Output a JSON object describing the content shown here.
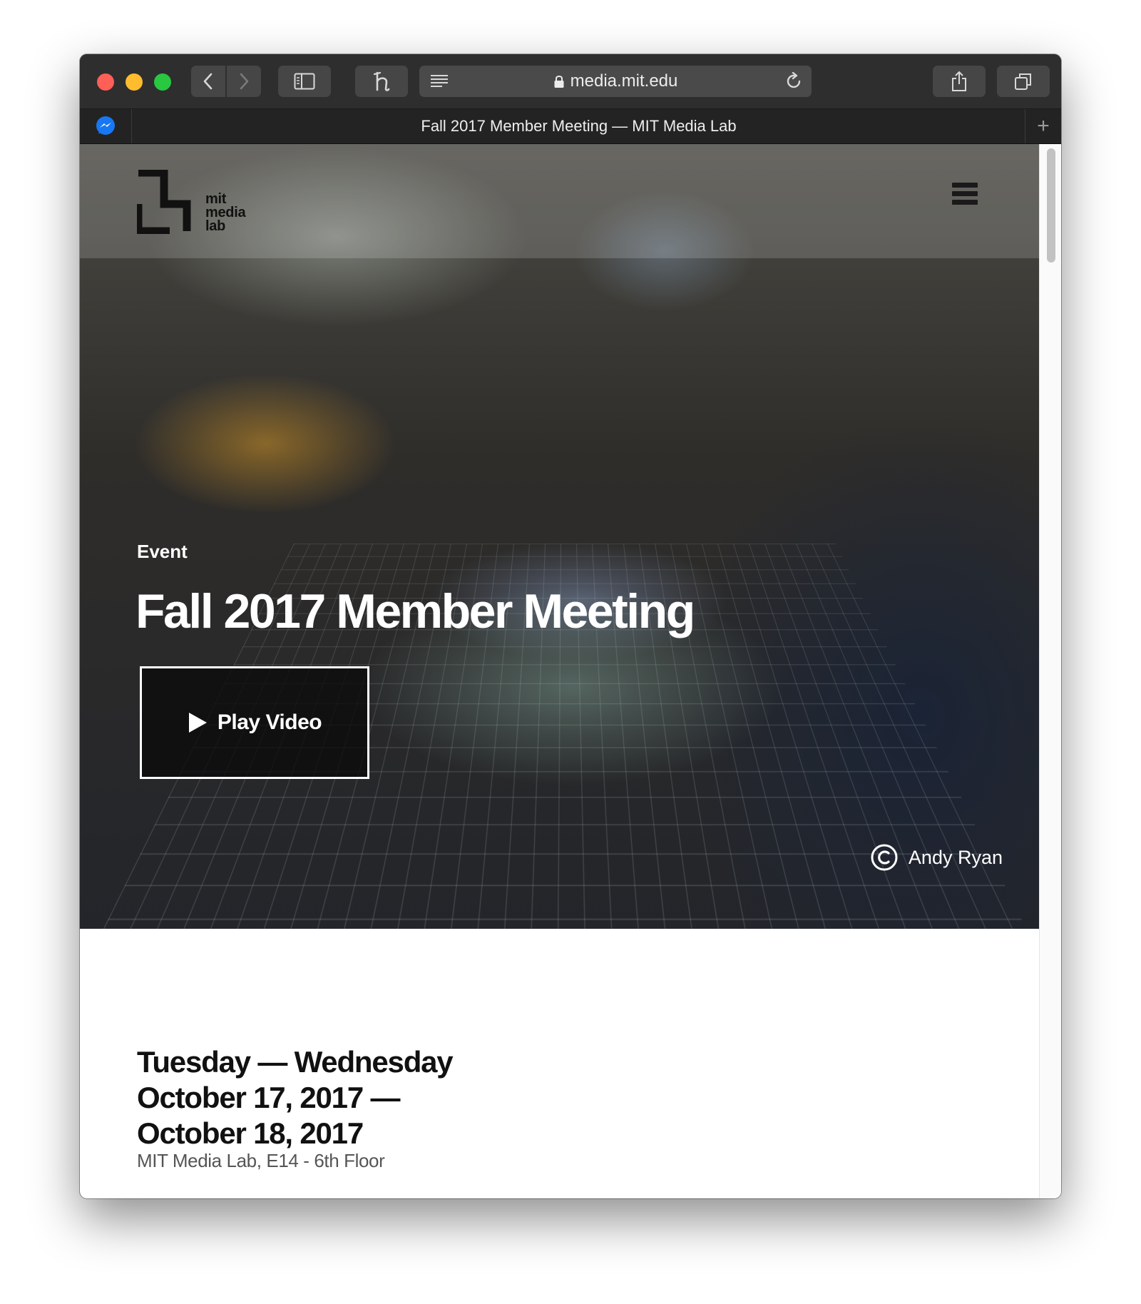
{
  "browser": {
    "url": "media.mit.edu",
    "tab_title": "Fall 2017 Member Meeting — MIT Media Lab",
    "new_tab_label": "+"
  },
  "site": {
    "logo_lines": [
      "mit",
      "media",
      "lab"
    ]
  },
  "hero": {
    "kicker": "Event",
    "title": "Fall 2017 Member Meeting",
    "play_label": "Play Video",
    "credit": "Andy Ryan"
  },
  "event": {
    "date_lines": [
      "Tuesday — Wednesday",
      "October 17, 2017 —",
      "October 18, 2017"
    ],
    "location": "MIT Media Lab, E14 - 6th Floor"
  },
  "icons": {
    "close": "close-circle",
    "minimize": "minimize-circle",
    "maximize": "maximize-circle",
    "back": "chevron-left-icon",
    "forward": "chevron-right-icon",
    "sidebar": "sidebar-icon",
    "extension": "extension-h-icon",
    "reader": "reader-lines-icon",
    "lock": "lock-icon",
    "reload": "reload-icon",
    "share": "share-icon",
    "tabs": "tabs-overview-icon",
    "messenger": "messenger-icon",
    "menu": "hamburger-menu-icon",
    "copyright": "copyright-icon"
  },
  "colors": {
    "toolbar": "#2e2e2e",
    "close": "#fe5f57",
    "minimize": "#febc2e",
    "maximize": "#28c840",
    "messenger": "#1877f2"
  }
}
